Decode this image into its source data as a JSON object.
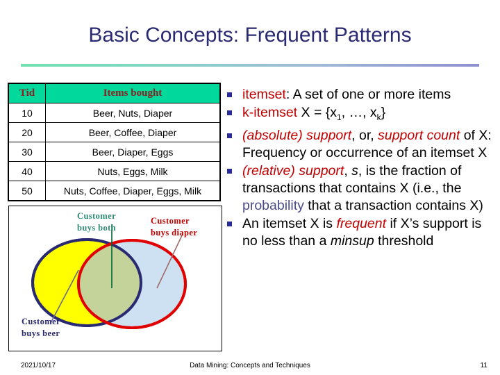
{
  "slide": {
    "title": "Basic Concepts: Frequent Patterns"
  },
  "table": {
    "headers": [
      "Tid",
      "Items bought"
    ],
    "rows": [
      {
        "tid": "10",
        "items": "Beer, Nuts, Diaper"
      },
      {
        "tid": "20",
        "items": "Beer, Coffee, Diaper"
      },
      {
        "tid": "30",
        "items": "Beer, Diaper, Eggs"
      },
      {
        "tid": "40",
        "items": "Nuts, Eggs, Milk"
      },
      {
        "tid": "50",
        "items": "Nuts, Coffee, Diaper, Eggs, Milk"
      }
    ]
  },
  "venn": {
    "label_both_line1": "Customer",
    "label_both_line2": "buys both",
    "label_diaper_line1": "Customer",
    "label_diaper_line2": "buys diaper",
    "label_beer_line1": "Customer",
    "label_beer_line2": "buys beer",
    "colors": {
      "beer_fill": "#ffff00",
      "beer_stroke": "#2a2a72",
      "diaper_fill": "#c6dcf0",
      "diaper_stroke": "#e00000",
      "both_fill": "#c3d39a",
      "label_both": "#2e8b74",
      "label_diaper": "#c00000",
      "label_beer": "#2a2a72",
      "leader_both": "#006633",
      "leader_diaper": "#996666",
      "leader_beer": "#555577"
    }
  },
  "bullets": [
    {
      "id": "itemset",
      "term": "itemset",
      "rest": ": A set of one or more items"
    },
    {
      "id": "k-itemset",
      "term": "k-itemset",
      "rest": " X = {x1, …, xk}"
    },
    {
      "id": "absolute-support",
      "term": "(absolute) support",
      "mid": ", or, ",
      "term2": "support count",
      "rest": " of X: Frequency or occurrence of an itemset X"
    },
    {
      "id": "relative-support",
      "term": "(relative) support",
      "rest": ", s, is the fraction of transactions that contains X (i.e., the probability that a transaction contains X)",
      "highlight": "probability"
    },
    {
      "id": "frequent",
      "lead": "An itemset X is ",
      "term": "frequent",
      "rest": " if X’s support is no less than a minsup threshold",
      "italic": "minsup"
    }
  ],
  "footer": {
    "date": "2021/10/17",
    "center": "Data Mining: Concepts and Techniques",
    "page": "11"
  }
}
